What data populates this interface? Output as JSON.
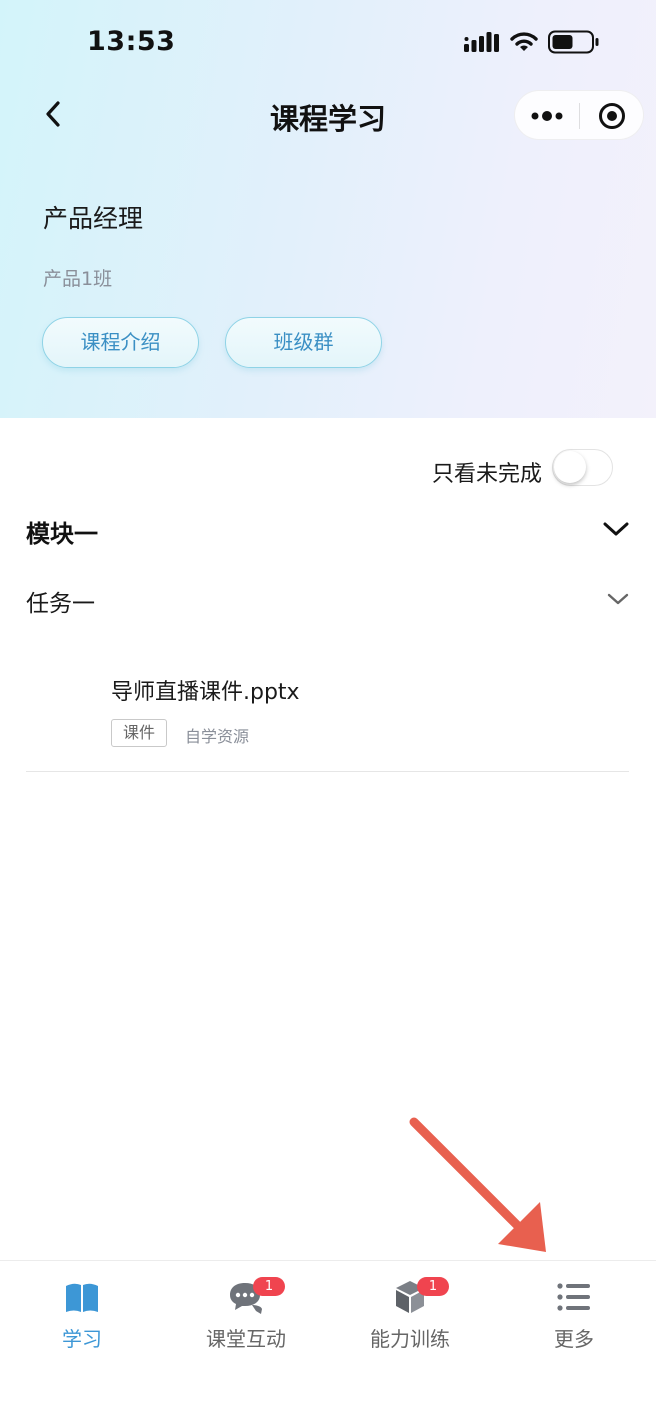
{
  "status_bar": {
    "time": "13:53"
  },
  "nav": {
    "title": "课程学习"
  },
  "course": {
    "name": "产品经理",
    "class_name": "产品1班",
    "buttons": {
      "intro": "课程介绍",
      "group": "班级群"
    }
  },
  "filter": {
    "label": "只看未完成",
    "enabled": false
  },
  "module": {
    "title": "模块一",
    "task": {
      "title": "任务一",
      "items": [
        {
          "name": "导师直播课件.pptx",
          "tag": "课件",
          "source": "自学资源"
        }
      ]
    }
  },
  "tabbar": {
    "items": [
      {
        "label": "学习",
        "icon": "book-icon",
        "active": true
      },
      {
        "label": "课堂互动",
        "icon": "chat-bubbles-icon",
        "badge": "1"
      },
      {
        "label": "能力训练",
        "icon": "cube-icon",
        "badge": "1"
      },
      {
        "label": "更多",
        "icon": "list-icon"
      }
    ]
  },
  "colors": {
    "accent": "#3d97d6",
    "badge": "#f0444f",
    "annotation_arrow": "#e8604f"
  }
}
